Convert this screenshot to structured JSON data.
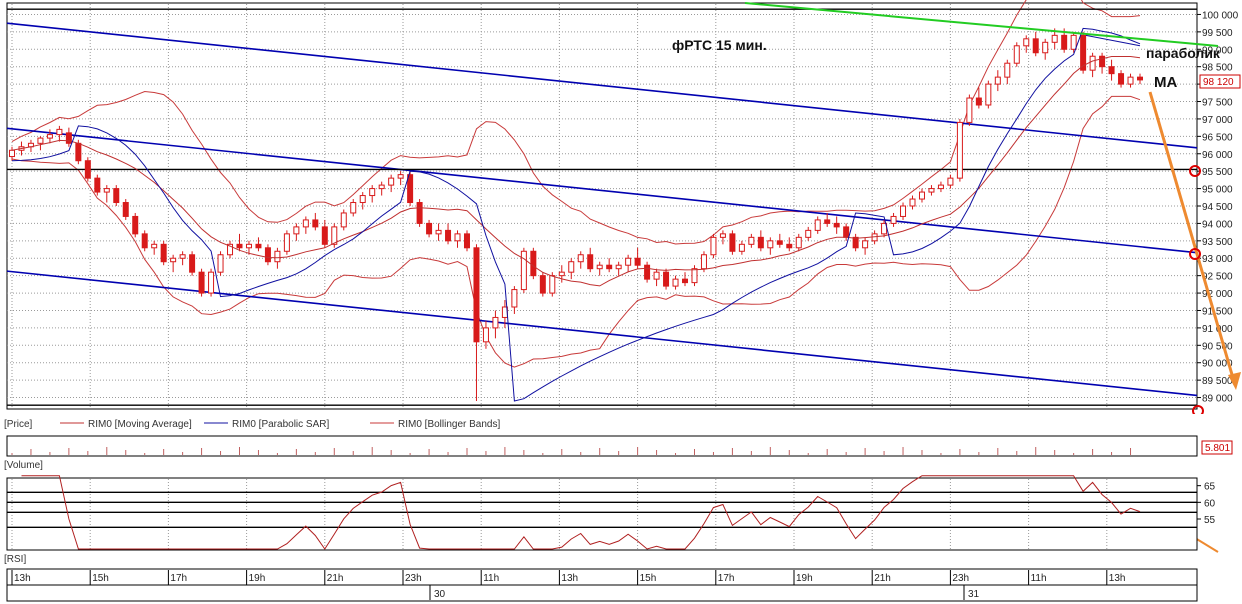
{
  "chart_data": {
    "type": "candlestick",
    "title": "фРТС   15 мин.",
    "annotations": {
      "parabolic": "параболик",
      "ma": "МА"
    },
    "price_axis": {
      "ylim": [
        88700,
        100300
      ],
      "ticks": [
        "100 000",
        "99 500",
        "99 000",
        "98 500",
        "98 000",
        "97 500",
        "97 000",
        "96 500",
        "96 000",
        "95 500",
        "95 000",
        "94 500",
        "94 000",
        "93 500",
        "93 000",
        "92 500",
        "92 000",
        "91 500",
        "91 000",
        "90 500",
        "90 000",
        "89 500",
        "89 000"
      ],
      "tick_values": [
        100000,
        99500,
        99000,
        98500,
        98000,
        97500,
        97000,
        96500,
        96000,
        95500,
        95000,
        94500,
        94000,
        93500,
        93000,
        92500,
        92000,
        91500,
        91000,
        90500,
        90000,
        89500,
        89000
      ],
      "last_price": "98 120"
    },
    "candles": [
      [
        95920,
        96200,
        95800,
        96100
      ],
      [
        96100,
        96350,
        95950,
        96200
      ],
      [
        96200,
        96400,
        96050,
        96300
      ],
      [
        96300,
        96500,
        96100,
        96450
      ],
      [
        96450,
        96700,
        96300,
        96550
      ],
      [
        96550,
        96800,
        96350,
        96700
      ],
      [
        96600,
        96750,
        96200,
        96300
      ],
      [
        96300,
        96400,
        95700,
        95800
      ],
      [
        95800,
        95900,
        95200,
        95300
      ],
      [
        95300,
        95400,
        94800,
        94900
      ],
      [
        94900,
        95100,
        94600,
        95000
      ],
      [
        95000,
        95100,
        94500,
        94600
      ],
      [
        94600,
        94700,
        94100,
        94200
      ],
      [
        94200,
        94300,
        93600,
        93700
      ],
      [
        93700,
        93800,
        93200,
        93300
      ],
      [
        93300,
        93500,
        93100,
        93400
      ],
      [
        93400,
        93500,
        92800,
        92900
      ],
      [
        92900,
        93100,
        92600,
        93000
      ],
      [
        93000,
        93200,
        92800,
        93100
      ],
      [
        93100,
        93200,
        92500,
        92600
      ],
      [
        92600,
        92700,
        91900,
        92000
      ],
      [
        92000,
        92700,
        91900,
        92600
      ],
      [
        92600,
        93200,
        92500,
        93100
      ],
      [
        93100,
        93500,
        93000,
        93400
      ],
      [
        93400,
        93700,
        93200,
        93300
      ],
      [
        93300,
        93500,
        93100,
        93400
      ],
      [
        93400,
        93600,
        93200,
        93300
      ],
      [
        93300,
        93400,
        92800,
        92900
      ],
      [
        92900,
        93300,
        92700,
        93200
      ],
      [
        93200,
        93800,
        93100,
        93700
      ],
      [
        93700,
        94000,
        93500,
        93900
      ],
      [
        93900,
        94200,
        93700,
        94100
      ],
      [
        94100,
        94300,
        93800,
        93900
      ],
      [
        93900,
        94100,
        93300,
        93400
      ],
      [
        93400,
        94000,
        93300,
        93900
      ],
      [
        93900,
        94400,
        93800,
        94300
      ],
      [
        94300,
        94700,
        94200,
        94600
      ],
      [
        94600,
        94900,
        94400,
        94800
      ],
      [
        94800,
        95100,
        94600,
        95000
      ],
      [
        95000,
        95200,
        94800,
        95100
      ],
      [
        95100,
        95400,
        94900,
        95300
      ],
      [
        95300,
        95500,
        95100,
        95400
      ],
      [
        95400,
        95500,
        94500,
        94600
      ],
      [
        94600,
        94700,
        93900,
        94000
      ],
      [
        94000,
        94100,
        93600,
        93700
      ],
      [
        93700,
        94000,
        93500,
        93800
      ],
      [
        93800,
        94000,
        93400,
        93500
      ],
      [
        93500,
        93800,
        93300,
        93700
      ],
      [
        93700,
        93800,
        93200,
        93300
      ],
      [
        93300,
        93400,
        88900,
        90600
      ],
      [
        90600,
        91200,
        90400,
        91000
      ],
      [
        91000,
        91500,
        90700,
        91300
      ],
      [
        91300,
        91800,
        91000,
        91600
      ],
      [
        91600,
        92200,
        91400,
        92100
      ],
      [
        92100,
        93300,
        92000,
        93200
      ],
      [
        93200,
        93300,
        92400,
        92500
      ],
      [
        92500,
        92600,
        91900,
        92000
      ],
      [
        92000,
        92600,
        91900,
        92500
      ],
      [
        92500,
        92800,
        92300,
        92600
      ],
      [
        92600,
        93000,
        92400,
        92900
      ],
      [
        92900,
        93200,
        92700,
        93100
      ],
      [
        93100,
        93300,
        92600,
        92700
      ],
      [
        92700,
        92900,
        92500,
        92800
      ],
      [
        92800,
        93000,
        92600,
        92700
      ],
      [
        92700,
        92900,
        92500,
        92800
      ],
      [
        92800,
        93100,
        92600,
        93000
      ],
      [
        93000,
        93300,
        92700,
        92800
      ],
      [
        92800,
        92900,
        92300,
        92400
      ],
      [
        92400,
        92700,
        92200,
        92600
      ],
      [
        92600,
        92700,
        92100,
        92200
      ],
      [
        92200,
        92500,
        92100,
        92400
      ],
      [
        92400,
        92600,
        92200,
        92300
      ],
      [
        92300,
        92800,
        92200,
        92700
      ],
      [
        92700,
        93200,
        92600,
        93100
      ],
      [
        93100,
        93700,
        93000,
        93600
      ],
      [
        93600,
        93800,
        93400,
        93700
      ],
      [
        93700,
        93800,
        93100,
        93200
      ],
      [
        93200,
        93500,
        93100,
        93400
      ],
      [
        93400,
        93700,
        93300,
        93600
      ],
      [
        93600,
        93800,
        93200,
        93300
      ],
      [
        93300,
        93600,
        93100,
        93500
      ],
      [
        93500,
        93700,
        93300,
        93400
      ],
      [
        93400,
        93600,
        93200,
        93300
      ],
      [
        93300,
        93700,
        93200,
        93600
      ],
      [
        93600,
        93900,
        93500,
        93800
      ],
      [
        93800,
        94200,
        93700,
        94100
      ],
      [
        94100,
        94300,
        93900,
        94000
      ],
      [
        94000,
        94200,
        93700,
        93900
      ],
      [
        93900,
        94000,
        93500,
        93600
      ],
      [
        93600,
        93700,
        93200,
        93300
      ],
      [
        93300,
        93600,
        93100,
        93500
      ],
      [
        93500,
        93800,
        93400,
        93700
      ],
      [
        93700,
        94100,
        93600,
        94000
      ],
      [
        94000,
        94300,
        93900,
        94200
      ],
      [
        94200,
        94600,
        94100,
        94500
      ],
      [
        94500,
        94800,
        94400,
        94700
      ],
      [
        94700,
        95000,
        94600,
        94900
      ],
      [
        94900,
        95100,
        94800,
        95000
      ],
      [
        95000,
        95200,
        94900,
        95100
      ],
      [
        95100,
        95400,
        95000,
        95300
      ],
      [
        95300,
        97000,
        95200,
        96900
      ],
      [
        96900,
        97700,
        96800,
        97600
      ],
      [
        97600,
        97900,
        97300,
        97400
      ],
      [
        97400,
        98100,
        97300,
        98000
      ],
      [
        98000,
        98400,
        97800,
        98200
      ],
      [
        98200,
        98700,
        98000,
        98600
      ],
      [
        98600,
        99200,
        98500,
        99100
      ],
      [
        99100,
        99400,
        98900,
        99300
      ],
      [
        99300,
        99500,
        98800,
        98900
      ],
      [
        98900,
        99300,
        98700,
        99200
      ],
      [
        99200,
        99600,
        99000,
        99400
      ],
      [
        99400,
        99600,
        98900,
        99000
      ],
      [
        99000,
        99500,
        98900,
        99400
      ],
      [
        99400,
        99500,
        98300,
        98400
      ],
      [
        98400,
        98900,
        98200,
        98800
      ],
      [
        98800,
        98900,
        98300,
        98500
      ],
      [
        98500,
        98700,
        98100,
        98300
      ],
      [
        98300,
        98400,
        97900,
        98000
      ],
      [
        98000,
        98300,
        97900,
        98200
      ],
      [
        98200,
        98300,
        98000,
        98120
      ]
    ],
    "indicators": [
      "RIM0 (Moving Average)",
      "RIM0 (Parabolic SAR)",
      "RIM0 (Bollinger Bands)"
    ],
    "channel_lines": [
      {
        "color": "#0000b0",
        "from": [
          0,
          99750
        ],
        "to": [
          1,
          96170
        ]
      },
      {
        "color": "#0000b0",
        "from": [
          0,
          96730
        ],
        "to": [
          1,
          93160
        ]
      },
      {
        "color": "#0000b0",
        "from": [
          0,
          92630
        ],
        "to": [
          1,
          89060
        ]
      }
    ],
    "horizontal_lines": [
      95550,
      100150,
      88780
    ],
    "forecast_arrow": {
      "color": "#ee8a30"
    },
    "volume_value": "5.801",
    "rsi": {
      "ticks": [
        "65",
        "60",
        "55"
      ],
      "tick_values": [
        65,
        60,
        55
      ],
      "ylim": [
        46,
        67
      ],
      "levels": [
        63,
        60,
        57,
        52.5
      ]
    },
    "time_labels": [
      "13h",
      "15h",
      "17h",
      "19h",
      "21h",
      "23h",
      "11h",
      "13h",
      "15h",
      "17h",
      "19h",
      "21h",
      "23h",
      "11h",
      "13h"
    ],
    "date_labels": [
      "30",
      "31"
    ],
    "colors": {
      "up": "#ffffff",
      "down": "#d81a1a",
      "ma": "#c03030",
      "sar": "#1010a0",
      "bb": "#c83a3a",
      "channel": "#0000b0",
      "green": "#22cc22",
      "arrow": "#ee8a30"
    }
  },
  "panels": {
    "price_legend": "[Price]",
    "ma_legend": "RIM0 [Moving Average]",
    "sar_legend": "RIM0 [Parabolic SAR]",
    "bb_legend": "RIM0 [Bollinger Bands]",
    "volume_title": "[Volume]",
    "rsi_title": "[RSI]"
  }
}
